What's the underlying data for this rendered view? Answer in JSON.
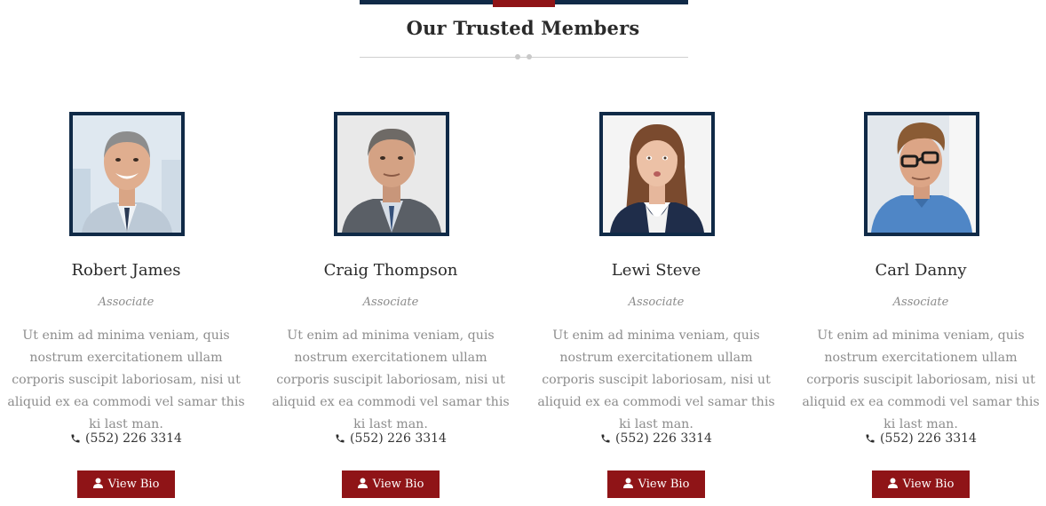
{
  "section": {
    "title": "Our Trusted Members"
  },
  "members": [
    {
      "name": "Robert James",
      "role": "Associate",
      "bio": "Ut enim ad minima veniam, quis nostrum exercitationem ullam corporis suscipit laboriosam, nisi ut aliquid ex ea commodi vel samar this ki last man.",
      "phone": "(552) 226 3314",
      "button_label": "View Bio"
    },
    {
      "name": "Craig Thompson",
      "role": "Associate",
      "bio": "Ut enim ad minima veniam, quis nostrum exercitationem ullam corporis suscipit laboriosam, nisi ut aliquid ex ea commodi vel samar this ki last man.",
      "phone": "(552) 226 3314",
      "button_label": "View Bio"
    },
    {
      "name": "Lewi Steve",
      "role": "Associate",
      "bio": "Ut enim ad minima veniam, quis nostrum exercitationem ullam corporis suscipit laboriosam, nisi ut aliquid ex ea commodi vel samar this ki last man.",
      "phone": "(552) 226 3314",
      "button_label": "View Bio"
    },
    {
      "name": "Carl Danny",
      "role": "Associate",
      "bio": "Ut enim ad minima veniam, quis nostrum exercitationem ullam corporis suscipit laboriosam, nisi ut aliquid ex ea commodi vel samar this ki last man.",
      "phone": "(552) 226 3314",
      "button_label": "View Bio"
    }
  ],
  "colors": {
    "navy": "#102a47",
    "accent_red": "#8f1417",
    "muted_text": "#8d8d8d"
  },
  "icons": {
    "phone": "phone-icon",
    "user": "user-icon"
  }
}
